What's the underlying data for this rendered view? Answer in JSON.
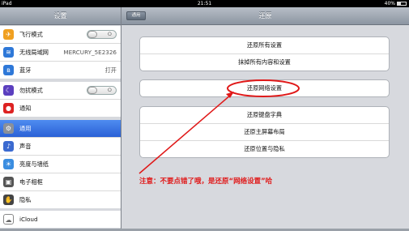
{
  "status": {
    "left": "iPad",
    "time": "21:51",
    "battery": "40%"
  },
  "master": {
    "title": "设置",
    "groups": [
      {
        "items": [
          {
            "label": "飞行模式",
            "toggle": "O"
          },
          {
            "label": "无线局域网",
            "value": "MERCURY_5E2326"
          },
          {
            "label": "蓝牙",
            "value": "打开"
          }
        ]
      },
      {
        "items": [
          {
            "label": "勿扰模式",
            "toggle": "O"
          },
          {
            "label": "通知"
          }
        ]
      },
      {
        "items": [
          {
            "label": "通用"
          },
          {
            "label": "声音"
          },
          {
            "label": "亮度与墙纸"
          },
          {
            "label": "电子相框"
          },
          {
            "label": "隐私"
          }
        ]
      },
      {
        "items": [
          {
            "label": "iCloud"
          }
        ]
      }
    ]
  },
  "detail": {
    "title": "还原",
    "back_label": "通用",
    "groups": [
      {
        "buttons": [
          "还原所有设置",
          "抹掉所有内容和设置"
        ]
      },
      {
        "buttons": [
          "还原网络设置"
        ]
      },
      {
        "buttons": [
          "还原键盘字典",
          "还原主屏幕布局",
          "还原位置与隐私"
        ]
      }
    ]
  },
  "annotation": {
    "text": "注意：不要点错了哦，是还原“网络设置”哈",
    "color": "#e01818"
  },
  "icons": [
    "airplane-icon",
    "wifi-icon",
    "bluetooth-icon",
    "moon-icon",
    "notification-icon",
    "gear-icon",
    "speaker-icon",
    "brightness-icon",
    "picture-frame-icon",
    "hand-icon",
    "cloud-icon"
  ]
}
